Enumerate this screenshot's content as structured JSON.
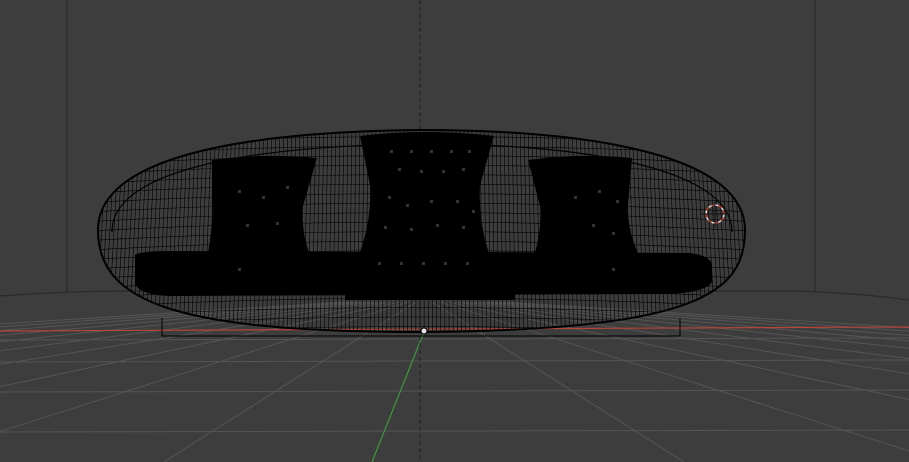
{
  "viewport": {
    "mode": "wireframe",
    "view": "front-perspective",
    "background_color": "#3d3d3d",
    "grid_color": "#555555",
    "x_axis_color": "#b5463a",
    "y_axis_color": "#3b9a3b",
    "wire_color": "#000000"
  },
  "scene": {
    "object": "pod-sofa",
    "cushions": [
      "left-cushion",
      "center-cushion",
      "right-cushion"
    ],
    "cursor_icon": "3d-cursor-icon",
    "origin_icon": "object-origin-icon"
  }
}
